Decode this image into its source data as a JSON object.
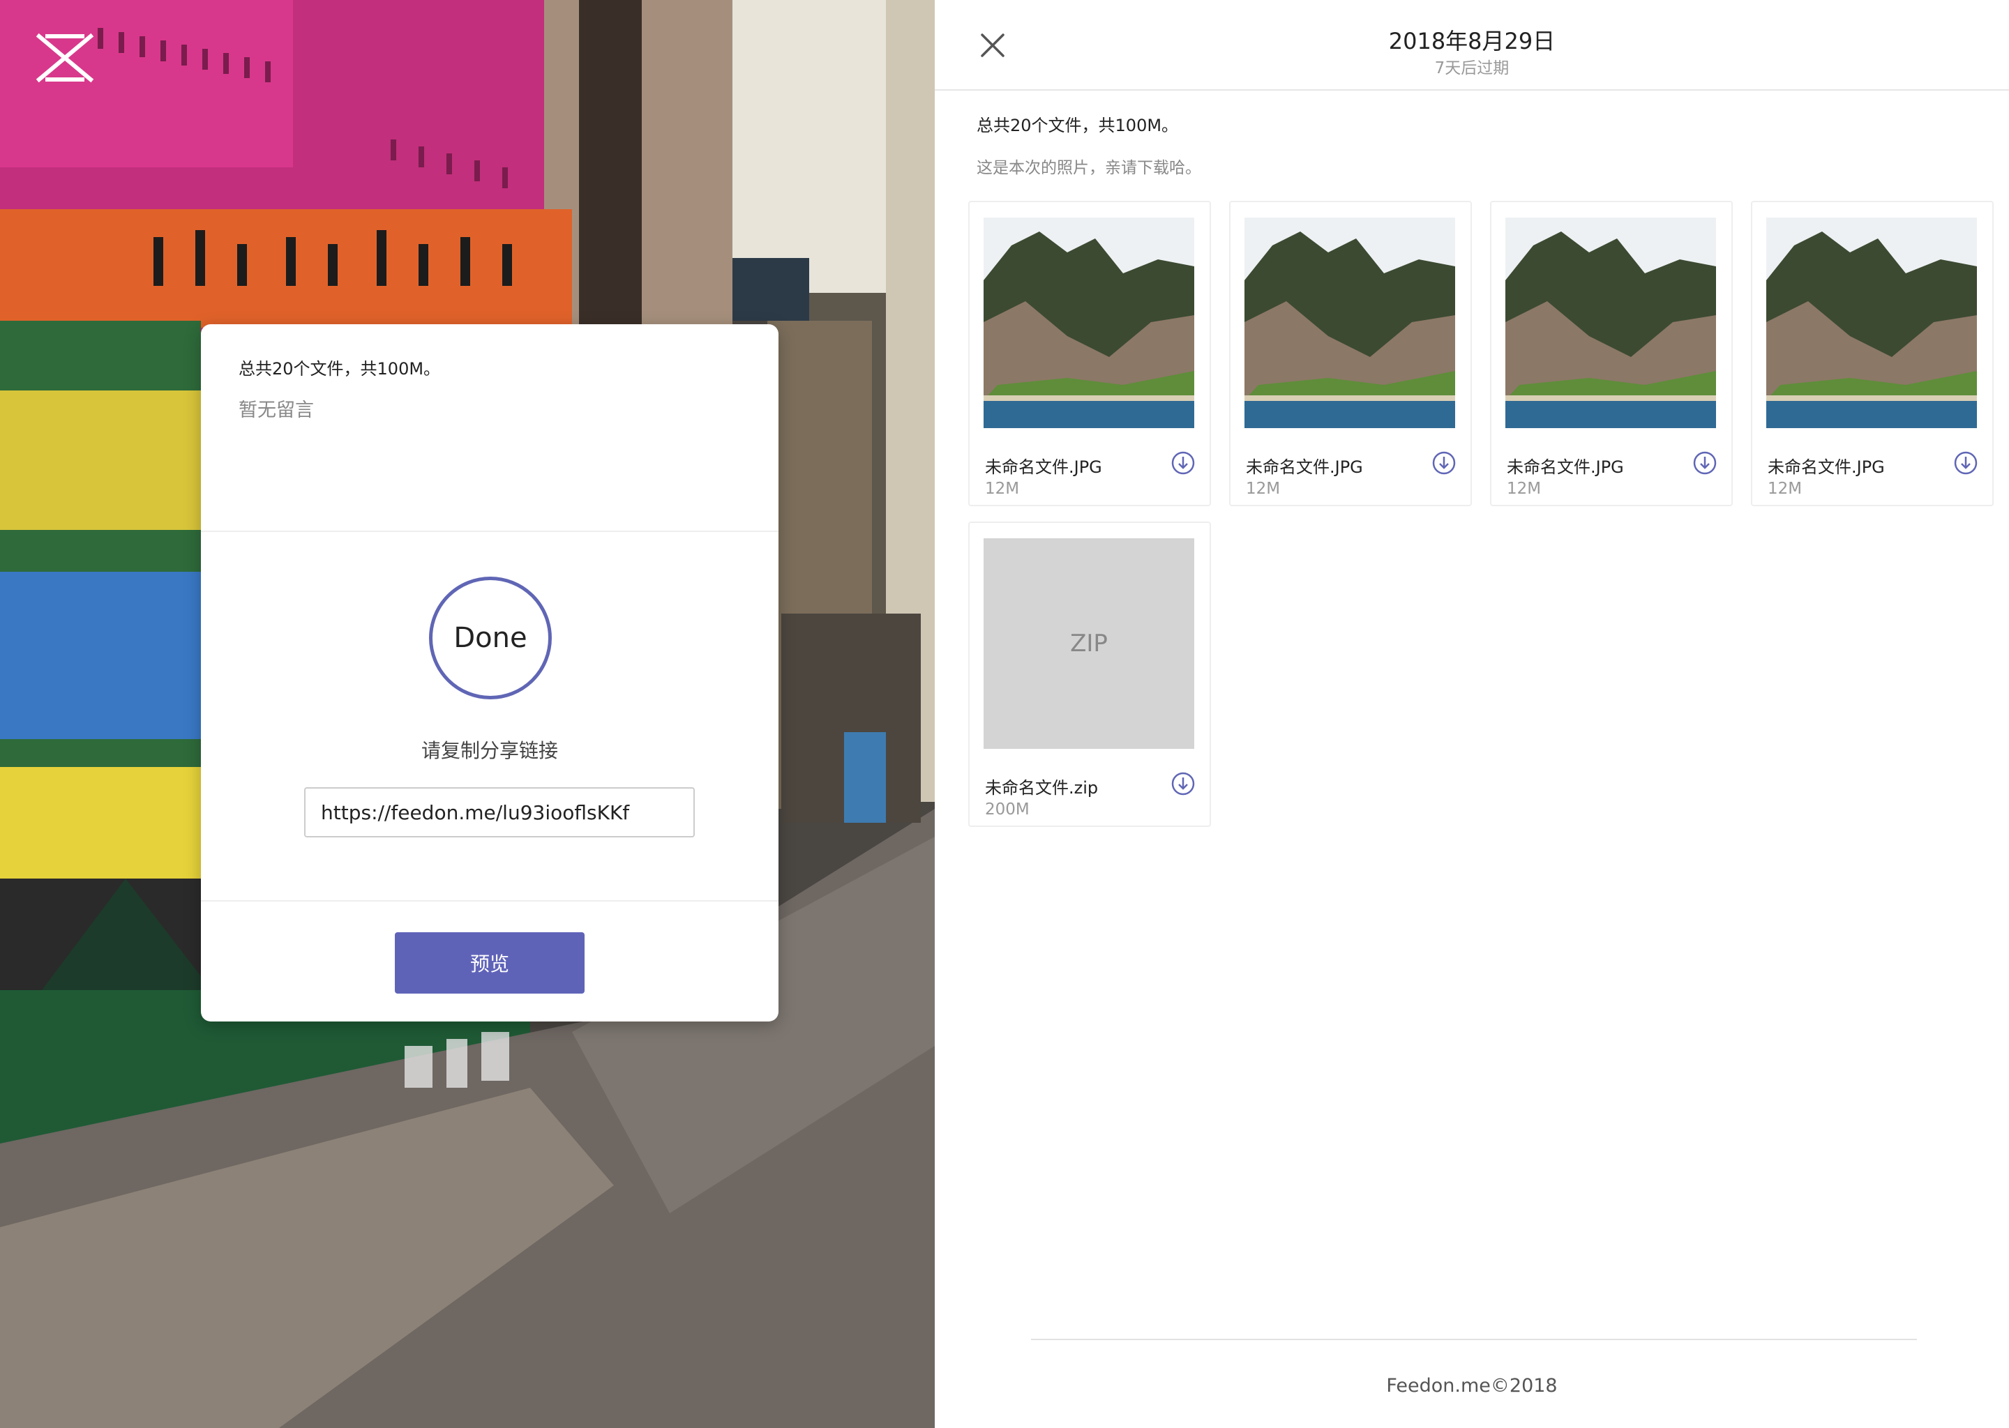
{
  "left": {
    "card": {
      "summary": "总共20个文件，共100M。",
      "message": "暂无留言",
      "status": "Done",
      "copy_label": "请复制分享链接",
      "share_link": "https://feedon.me/lu93iooflsKKf",
      "preview_label": "预览"
    },
    "accent_color": "#5f63b8"
  },
  "right": {
    "header": {
      "date": "2018年8月29日",
      "expire": "7天后过期"
    },
    "summary": "总共20个文件，共100M。",
    "note": "这是本次的照片，亲请下载哈。",
    "files": [
      {
        "name": "未命名文件.JPG",
        "size": "12M",
        "kind": "image"
      },
      {
        "name": "未命名文件.JPG",
        "size": "12M",
        "kind": "image"
      },
      {
        "name": "未命名文件.JPG",
        "size": "12M",
        "kind": "image"
      },
      {
        "name": "未命名文件.JPG",
        "size": "12M",
        "kind": "image"
      },
      {
        "name": "未命名文件.zip",
        "size": "200M",
        "kind": "zip",
        "thumb_label": "ZIP"
      }
    ],
    "footer": "Feedon.me©2018"
  },
  "icons": {
    "logo": "x-logo-icon",
    "close": "close-icon",
    "download": "download-circle-icon"
  }
}
